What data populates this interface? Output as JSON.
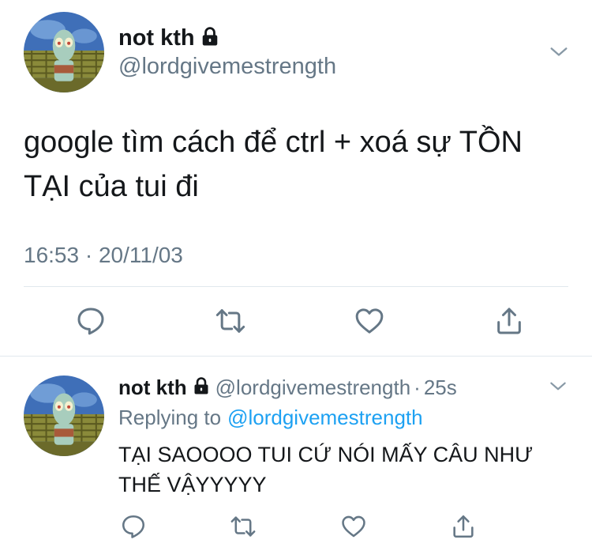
{
  "main_tweet": {
    "display_name": "not kth",
    "handle": "@lordgivemestrength",
    "text_line1": "google tìm cách để ctrl + xoá sự TỒN",
    "text_line2": "TẠI của tui đi",
    "timestamp": "16:53 · 20/11/03"
  },
  "reply_tweet": {
    "display_name": "not kth",
    "handle": "@lordgivemestrength",
    "separator": "·",
    "age": "25s",
    "replying_prefix": "Replying to",
    "replying_handle": "@lordgivemestrength",
    "text_line1": "TẠI SAOOOO TUI CỨ NÓI MẤY CÂU NHƯ",
    "text_line2": "THẾ VẬYYYYY"
  },
  "icons": {
    "lock": "lock-icon",
    "chevron": "chevron-down-icon",
    "reply": "reply-icon",
    "retweet": "retweet-icon",
    "like": "heart-icon",
    "share": "share-icon"
  },
  "colors": {
    "text": "#14171a",
    "secondary": "#657786",
    "link": "#1da1f2",
    "divider": "#e1e8ed"
  }
}
